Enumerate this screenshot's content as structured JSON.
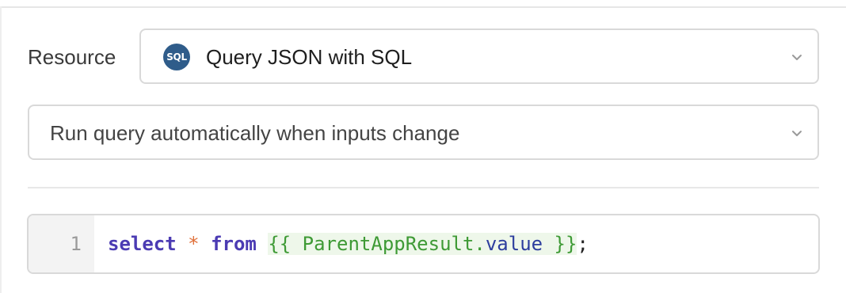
{
  "resource": {
    "label": "Resource",
    "icon": "sql-icon",
    "icon_text": "SQL",
    "value": "Query JSON with SQL"
  },
  "trigger": {
    "value": "Run query automatically when inputs change"
  },
  "editor": {
    "line_number": "1",
    "tokens": {
      "kw1": "select",
      "star": "*",
      "kw2": "from",
      "tpl_open": "{{ ",
      "tpl_ident": "ParentAppResult.",
      "tpl_prop": "value",
      "tpl_close": " }}",
      "semicolon": ";"
    }
  },
  "colors": {
    "keyword": "#4b3bb3",
    "operator": "#e0703a",
    "template": "#3e9a35",
    "template_bg": "#eef7ea",
    "icon_bg": "#2f5c8a"
  }
}
